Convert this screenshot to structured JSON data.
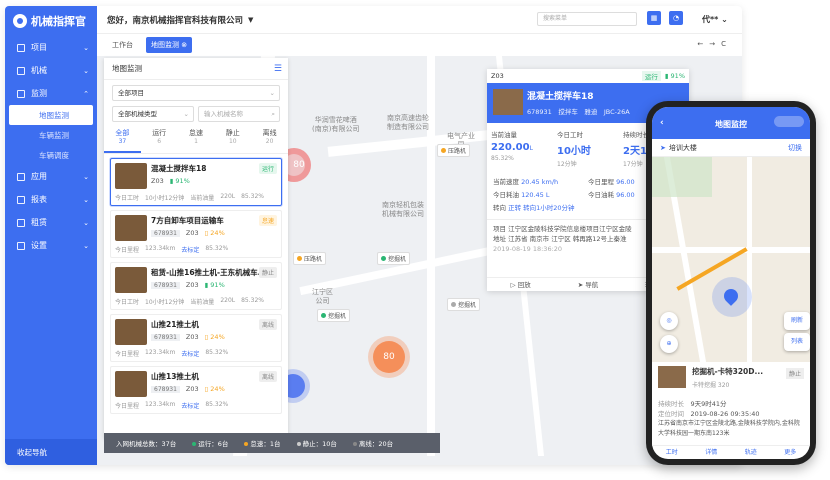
{
  "brand": {
    "name": "机械指挥官"
  },
  "sidebar": {
    "items": [
      {
        "label": "项目"
      },
      {
        "label": "机械"
      },
      {
        "label": "监测"
      },
      {
        "label": "应用"
      },
      {
        "label": "报表"
      },
      {
        "label": "租赁"
      },
      {
        "label": "设置"
      }
    ],
    "sub": [
      "地图监测",
      "车辆监测",
      "车辆调度"
    ],
    "collapse": "收起导航"
  },
  "header": {
    "greeting": "您好，南京机械指挥官科技有限公司",
    "search_placeholder": "搜索菜单",
    "user": "代**"
  },
  "tabs": {
    "home": "工作台",
    "current": "地图监测"
  },
  "map": {
    "pois": [
      "华润雪花啤酒\n(南京)有限公司",
      "南京高速齿轮\n制造有限公司",
      "南京轻机包装\n机械有限公司",
      "江宁区\n公司",
      "电气产业\n园"
    ],
    "clusters": [
      {
        "label": "80",
        "color": "#f58f5a"
      },
      {
        "label": "80",
        "color": "#f07070"
      },
      {
        "label": "",
        "color": "#5a7df0"
      }
    ],
    "pins": [
      "挖掘机",
      "挖掘机",
      "挖掘机",
      "压路机",
      "压路机",
      "挖掘机"
    ]
  },
  "list": {
    "title": "地图监测",
    "project_select": "全部项目",
    "type_select": "全部机械类型",
    "name_placeholder": "输入机械名称",
    "tabs": [
      {
        "label": "全部",
        "n": "37"
      },
      {
        "label": "运行",
        "n": "6"
      },
      {
        "label": "怠速",
        "n": "1"
      },
      {
        "label": "静止",
        "n": "10"
      },
      {
        "label": "离线",
        "n": "20"
      }
    ],
    "vehicles": [
      {
        "name": "混凝土搅拌车18",
        "tag": "运行",
        "plate": "",
        "code": "Z03",
        "pct": "91%",
        "foot1": "今日工时",
        "foot2": "10小时12分钟",
        "foot3": "当前油量",
        "foot4": "220L",
        "foot5": "85.32%"
      },
      {
        "name": "7方自卸车项目运输车",
        "tag": "怠速",
        "plate": "678931",
        "code": "Z03",
        "pct": "24%",
        "foot1": "今日里程",
        "foot2": "123.34km",
        "foot3": "去标定",
        "foot4": "",
        "foot5": "85.32%"
      },
      {
        "name": "租赁-山推16推土机-王东机械车...",
        "tag": "静止",
        "plate": "678931",
        "code": "Z03",
        "pct": "91%",
        "foot1": "今日工时",
        "foot2": "10小时12分钟",
        "foot3": "当前油量",
        "foot4": "220L",
        "foot5": "85.32%"
      },
      {
        "name": "山推21推土机",
        "tag": "离线",
        "plate": "678931",
        "code": "Z03",
        "pct": "24%",
        "foot1": "今日里程",
        "foot2": "123.34km",
        "foot3": "去标定",
        "foot4": "",
        "foot5": "85.32%"
      },
      {
        "name": "山推13推土机",
        "tag": "离线",
        "plate": "678931",
        "code": "Z03",
        "pct": "24%",
        "foot1": "今日里程",
        "foot2": "123.34km",
        "foot3": "去标定",
        "foot4": "",
        "foot5": "85.32%"
      }
    ]
  },
  "statusbar": {
    "total": "入网机械总数：37台",
    "run": "运行：6台",
    "idle": "怠速：1台",
    "still": "静止：10台",
    "off": "离线：20台"
  },
  "detail": {
    "code": "Z03",
    "status": "运行",
    "pct": "91%",
    "title": "混凝土搅拌车18",
    "plate": "678931",
    "type": "搅拌车",
    "brand": "雅迪",
    "model": "JBC-26A",
    "m1": {
      "label": "当前油量",
      "value": "220.00",
      "unit": "L",
      "sub": "85.32%"
    },
    "m2": {
      "label": "今日工时",
      "value": "10小时",
      "sub": "12分钟"
    },
    "m3": {
      "label": "持续时长",
      "value": "2天10",
      "sub": "17分钟"
    },
    "kv": [
      [
        "当前速度",
        "20.45 km/h"
      ],
      [
        "今日里程",
        "96.00"
      ],
      [
        "今日耗油",
        "120.45 L"
      ],
      [
        "今日油耗",
        "96.00"
      ],
      [
        "转向",
        "正转 转向1小时20分钟"
      ],
      [
        "",
        ""
      ]
    ],
    "addr1": "项目 江宁区金陵科技学院信息楼项目江宁区金陵",
    "addr2": "地址 江苏省 南京市 江宁区 韩再路12号上秦淮",
    "time": "2019-08-19 18:36:20",
    "foot": [
      "回放",
      "导航",
      "详情"
    ]
  },
  "phone": {
    "title": "地图监控",
    "loc": "培训大楼",
    "switch": "切换",
    "card_title": "挖掘机-卡特320D...",
    "card_sub": "卡特挖掘 320",
    "card_tag": "静止",
    "k1": "持续时长",
    "v1": "9天9时41分",
    "k2": "定位时间",
    "v2": "2019-08-26 09:35:40",
    "addr": "江苏省南京市江宁区金陵北路,金陵科技学院内,金科院大学科技园一期东南123米",
    "nav": [
      "工时",
      "详情",
      "轨迹",
      "更多"
    ],
    "btn1": "刷新",
    "btn2": "列表"
  }
}
